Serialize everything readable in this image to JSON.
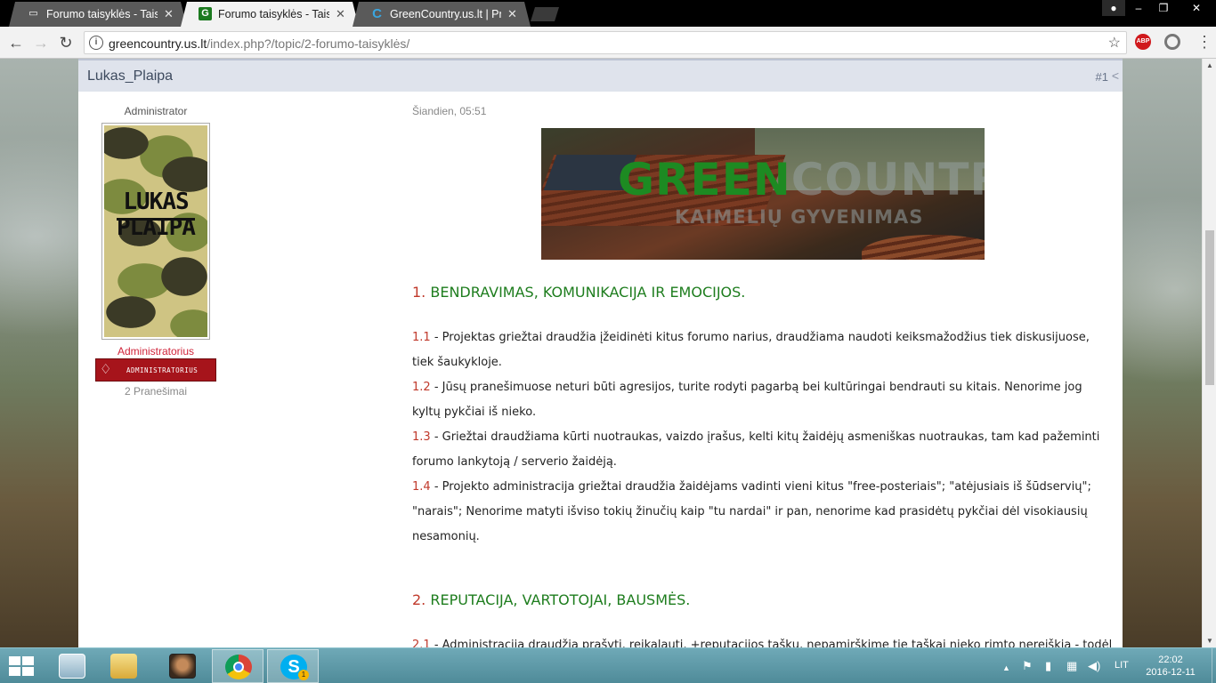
{
  "browser": {
    "tabs": [
      {
        "title": "Forumo taisyklės - Taisyk",
        "favicon": "document-icon",
        "active": false
      },
      {
        "title": "Forumo taisyklės - Taisyk",
        "favicon": "g-logo-icon",
        "active": true
      },
      {
        "title": "GreenCountry.us.lt | Prad",
        "favicon": "ips-logo-icon",
        "active": false
      }
    ],
    "url_host": "greencountry.us.lt",
    "url_path": "/index.php?/topic/2-forumo-taisyklės/",
    "abp_label": "ABP",
    "info_glyph": "i"
  },
  "post": {
    "author": "Lukas_Plaipa",
    "number": "#1",
    "role_title": "Administrator",
    "avatar_text_line1": "LUKAS",
    "avatar_text_line2": "PLAIPA",
    "group_name": "Administratorius",
    "rank_badge": "ADMINISTRATORIUS",
    "post_count": "2 Pranešimai",
    "date": "Šiandien, 05:51",
    "banner_logo_green": "GREEN",
    "banner_logo_rest": "COUNTRY.LT",
    "banner_subtitle": "KAIMELIŲ GYVENIMAS",
    "sections": [
      {
        "num": "1.",
        "title": "BENDRAVIMAS, KOMUNIKACIJA IR EMOCIJOS.",
        "rules": [
          {
            "num": "1.1",
            "text": " - Projektas griežtai draudžia įžeidinėti kitus forumo narius, draudžiama naudoti keiksmažodžius tiek diskusijuose, tiek šaukykloje."
          },
          {
            "num": "1.2",
            "text": " - Jūsų pranešimuose neturi būti agresijos, turite rodyti pagarbą bei kultūringai bendrauti su kitais. Nenorime jog kyltų pykčiai iš nieko."
          },
          {
            "num": "1.3",
            "text": " - Griežtai draudžiama kūrti nuotraukas, vaizdo įrašus, kelti kitų žaidėjų asmeniškas nuotraukas, tam kad pažeminti forumo lankytoją / serverio žaidėją."
          },
          {
            "num": "1.4",
            "text": " - Projekto administracija griežtai draudžia žaidėjams vadinti vieni kitus \"free-posteriais\"; \"atėjusiais iš šūdservių\"; \"narais\"; Nenorime matyti išviso tokių žinučių kaip \"tu nardai\" ir pan, nenorime kad prasidėtų pykčiai dėl visokiausių nesamonių."
          }
        ]
      },
      {
        "num": "2.",
        "title": "REPUTACIJA, VARTOTOJAI, BAUSMĖS.",
        "rules": [
          {
            "num": "2.1",
            "text": " - Administracija draudžia prašyti, reikalauti, +reputacijos taškų, nepamirškime tie taškai nieko rimto nereiškia - todėl"
          }
        ]
      }
    ]
  },
  "taskbar": {
    "apps": [
      "file-explorer-icon",
      "folder-icon",
      "gta-san-andreas-icon",
      "chrome-icon",
      "skype-icon"
    ],
    "skype_badge": "1",
    "language": "LIT",
    "time": "22:02",
    "date": "2016-12-11"
  }
}
